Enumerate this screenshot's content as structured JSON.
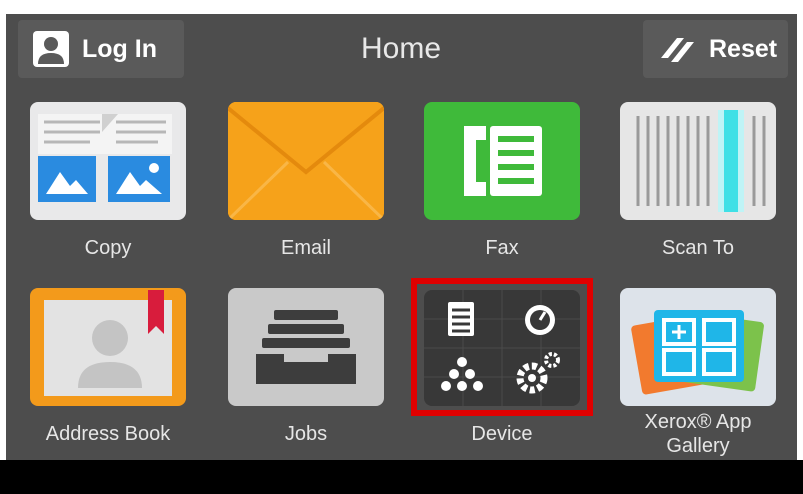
{
  "header": {
    "login_label": "Log In",
    "title": "Home",
    "reset_label": "Reset"
  },
  "apps": [
    {
      "label": "Copy",
      "icon": "copy-icon"
    },
    {
      "label": "Email",
      "icon": "email-icon"
    },
    {
      "label": "Fax",
      "icon": "fax-icon"
    },
    {
      "label": "Scan To",
      "icon": "scan-icon"
    },
    {
      "label": "Address Book",
      "icon": "address-book-icon"
    },
    {
      "label": "Jobs",
      "icon": "jobs-icon"
    },
    {
      "label": "Device",
      "icon": "device-icon",
      "highlighted": true
    },
    {
      "label_line1": "Xerox® App",
      "label_line2": "Gallery",
      "icon": "app-gallery-icon"
    }
  ],
  "colors": {
    "panel_bg": "#4d4d4d",
    "email_orange": "#f6a21a",
    "fax_green": "#3fba3a",
    "highlight_red": "#e00000",
    "gallery_blue": "#1fb6e8"
  }
}
